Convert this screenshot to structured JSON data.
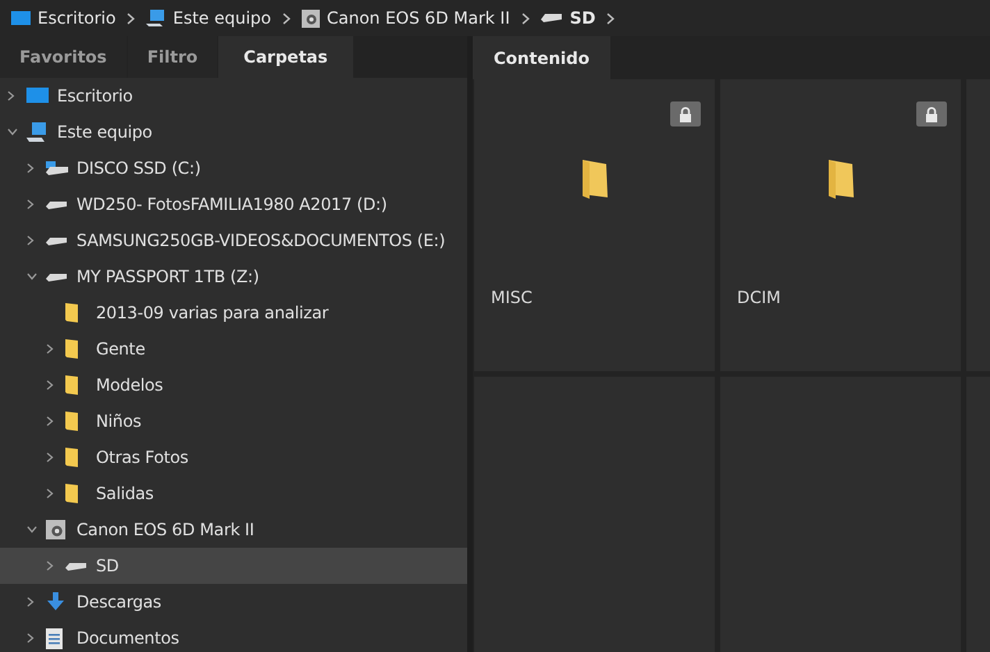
{
  "breadcrumb": [
    {
      "label": "Escritorio",
      "kind": "desktop",
      "current": false
    },
    {
      "label": "Este equipo",
      "kind": "computer",
      "current": false
    },
    {
      "label": "Canon EOS 6D Mark II",
      "kind": "camera",
      "current": false
    },
    {
      "label": "SD",
      "kind": "drive",
      "current": true
    }
  ],
  "left_tabs": [
    {
      "label": "Favoritos",
      "selected": false
    },
    {
      "label": "Filtro",
      "selected": false
    },
    {
      "label": "Carpetas",
      "selected": true
    }
  ],
  "tree": [
    {
      "label": "Escritorio",
      "kind": "desktop",
      "expanded": false,
      "selected": false
    },
    {
      "label": "Este equipo",
      "kind": "computer",
      "expanded": true,
      "selected": false,
      "children": [
        {
          "label": "DISCO SSD (C:)",
          "kind": "ssd",
          "expanded": false,
          "selected": false
        },
        {
          "label": "WD250- FotosFAMILIA1980 A2017 (D:)",
          "kind": "drive",
          "expanded": false,
          "selected": false
        },
        {
          "label": "SAMSUNG250GB-VIDEOS&DOCUMENTOS (E:)",
          "kind": "drive",
          "expanded": false,
          "selected": false
        },
        {
          "label": "MY PASSPORT 1TB (Z:)",
          "kind": "drive",
          "expanded": true,
          "selected": false,
          "children": [
            {
              "label": "2013-09 varias para analizar",
              "kind": "folder",
              "selected": false
            },
            {
              "label": "Gente",
              "kind": "folder",
              "expanded": false,
              "selected": false
            },
            {
              "label": "Modelos",
              "kind": "folder",
              "expanded": false,
              "selected": false
            },
            {
              "label": "Niños",
              "kind": "folder",
              "expanded": false,
              "selected": false
            },
            {
              "label": "Otras Fotos",
              "kind": "folder",
              "expanded": false,
              "selected": false
            },
            {
              "label": "Salidas",
              "kind": "folder",
              "expanded": false,
              "selected": false
            }
          ]
        },
        {
          "label": "Canon EOS 6D Mark II",
          "kind": "camera",
          "expanded": true,
          "selected": false,
          "children": [
            {
              "label": "SD",
              "kind": "drive",
              "expanded": false,
              "selected": true
            }
          ]
        },
        {
          "label": "Descargas",
          "kind": "download",
          "expanded": false,
          "selected": false
        },
        {
          "label": "Documentos",
          "kind": "documents",
          "expanded": false,
          "selected": false
        }
      ]
    }
  ],
  "content_tabs": [
    {
      "label": "Contenido",
      "selected": true
    }
  ],
  "items": [
    {
      "name": "MISC",
      "locked": true
    },
    {
      "name": "DCIM",
      "locked": true
    }
  ]
}
